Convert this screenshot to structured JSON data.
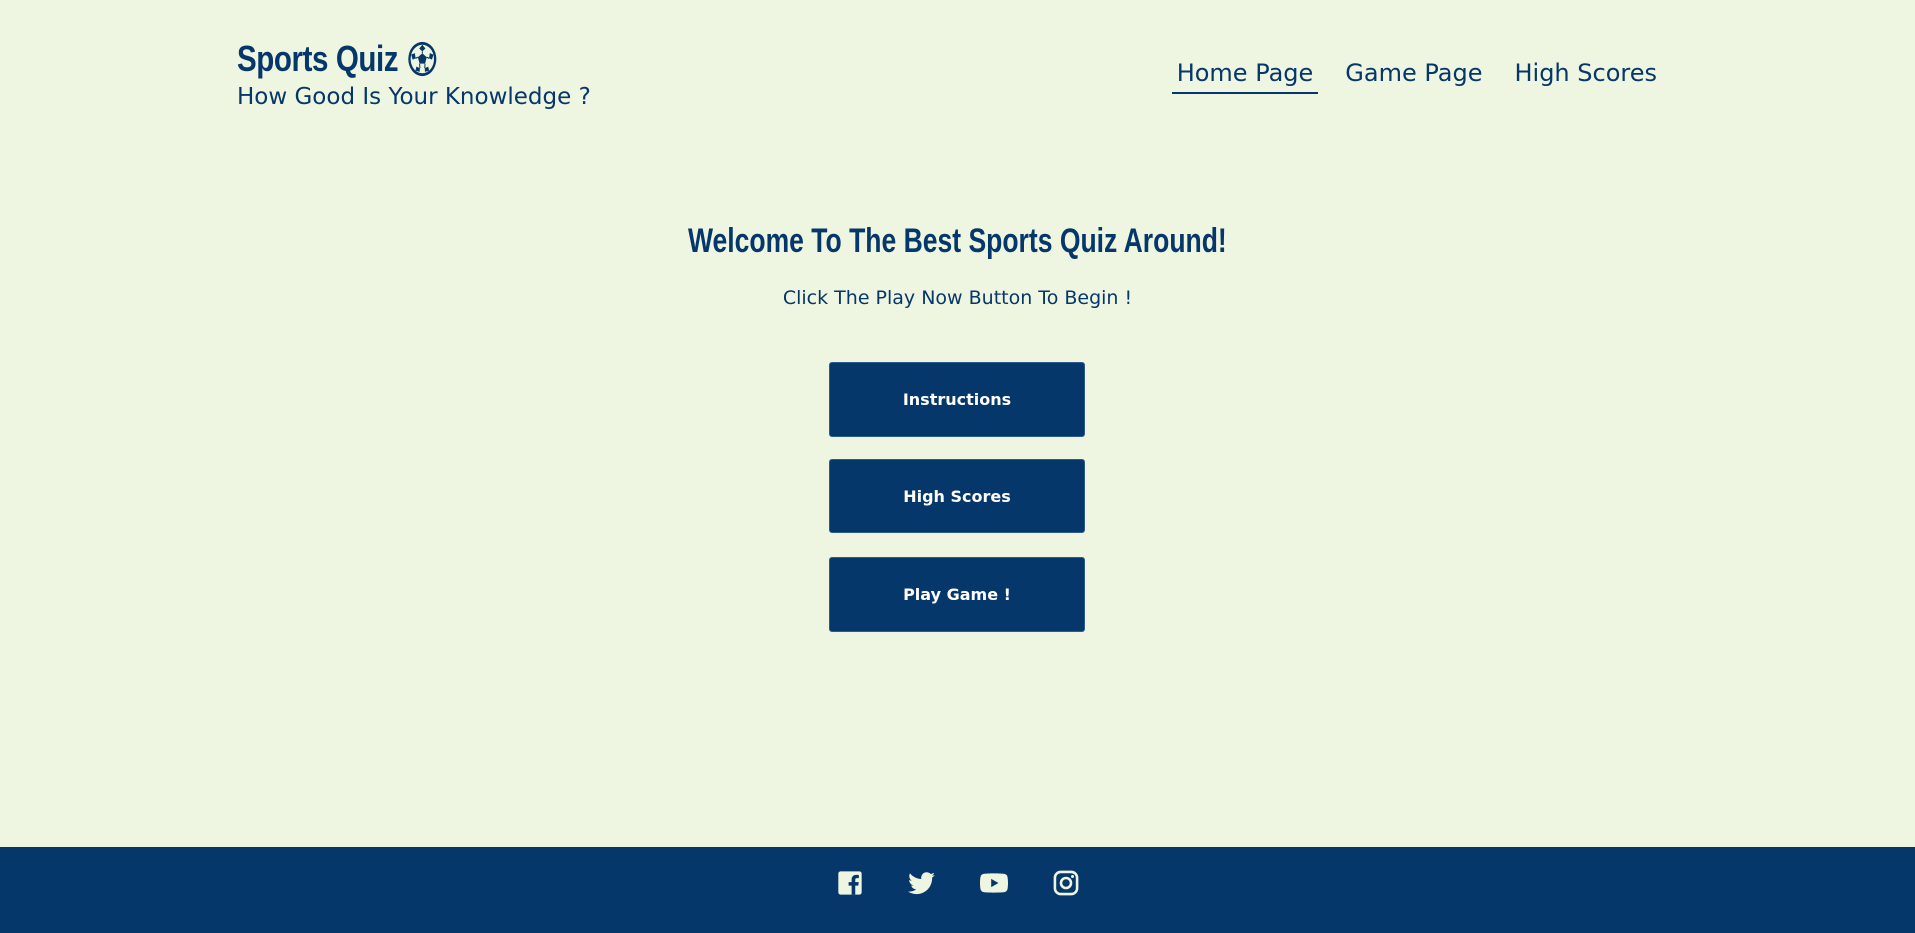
{
  "header": {
    "brand_title": "Sports Quiz",
    "brand_icon": "soccer-ball-icon",
    "brand_subtitle": "How Good Is Your Knowledge ?"
  },
  "nav": {
    "items": [
      {
        "label": "Home Page",
        "active": true
      },
      {
        "label": "Game Page",
        "active": false
      },
      {
        "label": "High Scores",
        "active": false
      }
    ]
  },
  "main": {
    "title": "Welcome To The Best Sports Quiz Around!",
    "subtitle": "Click The Play Now Button To Begin !",
    "buttons": [
      {
        "label": "Instructions"
      },
      {
        "label": "High Scores"
      },
      {
        "label": "Play Game !"
      }
    ]
  },
  "footer": {
    "social": [
      {
        "icon": "facebook-icon"
      },
      {
        "icon": "twitter-icon"
      },
      {
        "icon": "youtube-icon"
      },
      {
        "icon": "instagram-icon"
      }
    ]
  },
  "colors": {
    "background": "#eef5e0",
    "primary": "#06376a",
    "button_text": "#ffffff"
  }
}
